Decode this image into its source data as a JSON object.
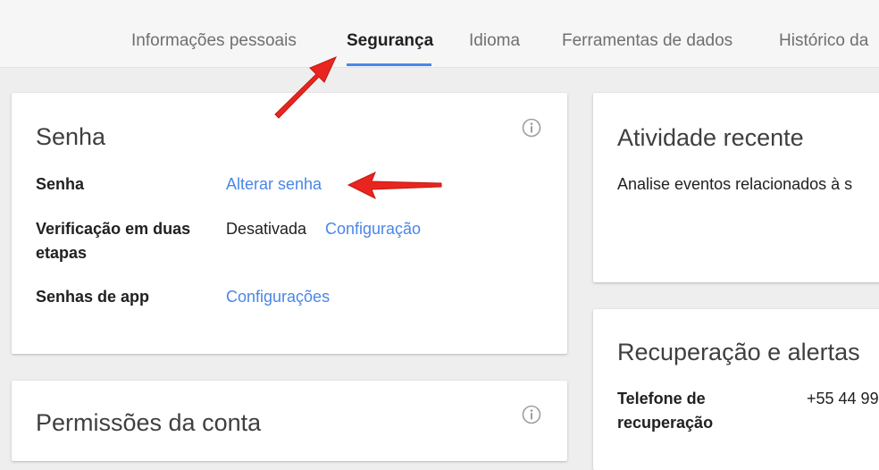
{
  "tabs": [
    {
      "label": "Informações pessoais"
    },
    {
      "label": "Segurança"
    },
    {
      "label": "Idioma"
    },
    {
      "label": "Ferramentas de dados"
    },
    {
      "label": "Histórico da"
    }
  ],
  "active_tab_index": 1,
  "password_card": {
    "title": "Senha",
    "rows": [
      {
        "label": "Senha",
        "link": "Alterar senha"
      },
      {
        "label": "Verificação em duas etapas",
        "status": "Desativada",
        "link": "Configuração"
      },
      {
        "label": "Senhas de app",
        "link": "Configurações"
      }
    ]
  },
  "permissions_card": {
    "title": "Permissões da conta"
  },
  "recent_activity_card": {
    "title": "Atividade recente",
    "description": "Analise eventos relacionados à s"
  },
  "recovery_card": {
    "title": "Recuperação e alertas",
    "phone_label": "Telefone de recuperação",
    "phone_value": "+55 44 99"
  },
  "icons": {
    "info": "info-icon",
    "annotation": "red-arrow-icon"
  },
  "colors": {
    "accent": "#4a86e8",
    "arrow": "#e8251f",
    "background": "#eeeeee"
  }
}
